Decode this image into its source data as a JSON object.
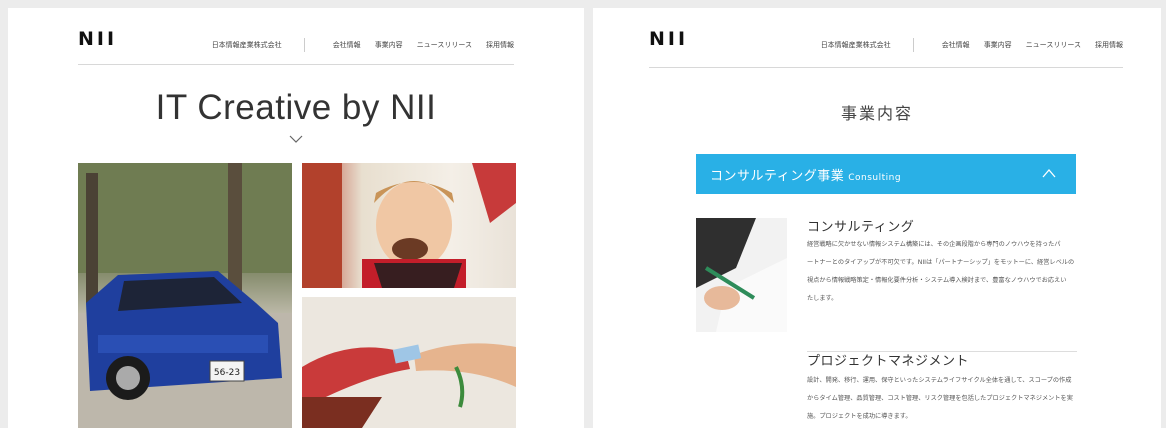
{
  "left_page": {
    "logo": "NII",
    "nav": {
      "company": "日本情報産業株式会社",
      "items": [
        "会社情報",
        "事業内容",
        "ニュースリリース",
        "採用情報"
      ]
    },
    "hero_title": "IT Creative by NII",
    "scroll_icon": "chevron-down-icon",
    "plate_text": "56-23"
  },
  "right_page": {
    "logo": "NII",
    "nav": {
      "company": "日本情報産業株式会社",
      "items": [
        "会社情報",
        "事業内容",
        "ニュースリリース",
        "採用情報"
      ]
    },
    "section_title": "事業内容",
    "accordion": {
      "title": "コンサルティング事業",
      "subtitle": "Consulting",
      "icon": "chevron-up-icon",
      "color": "#29b0e6"
    },
    "services": [
      {
        "title": "コンサルティング",
        "lines": [
          "経営戦略に欠かせない情報システム構築には、その企画段階から専門のノウハウを持ったパ",
          "ートナーとのタイアップが不可欠です。NIIは「パートナーシップ」をモットーに、経営レベルの",
          "視点から情報戦略策定・情報化要件分析・システム導入検討まで、豊富なノウハウでお応えい",
          "たします。"
        ]
      },
      {
        "title": "プロジェクトマネジメント",
        "lines": [
          "設計、開発、移行、運用、保守といったシステムライフサイクル全体を通して、スコープの作成",
          "からタイム管理、品質管理、コスト管理、リスク管理を包括したプロジェクトマネジメントを実",
          "施。プロジェクトを成功に導きます。"
        ]
      }
    ]
  }
}
